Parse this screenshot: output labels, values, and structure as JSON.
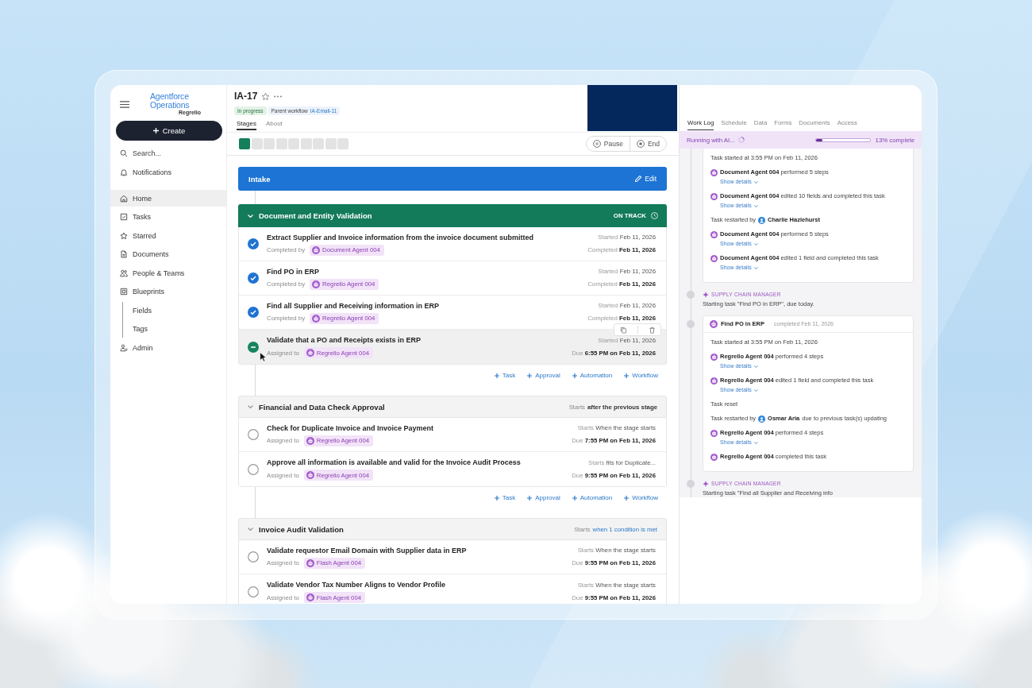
{
  "sidebar": {
    "logo": {
      "name": "Agentforce Operations",
      "byline": "Regrello"
    },
    "create_button": "Create",
    "search": {
      "placeholder": "Search..."
    },
    "top_items": [
      {
        "label": "Notifications",
        "selected": false
      }
    ],
    "items": [
      {
        "label": "Home",
        "selected": true
      },
      {
        "label": "Tasks",
        "selected": false
      },
      {
        "label": "Starred",
        "selected": false
      },
      {
        "label": "Documents",
        "selected": false
      },
      {
        "label": "People & Teams",
        "selected": false
      },
      {
        "label": "Blueprints",
        "selected": false,
        "children": [
          {
            "label": "Fields",
            "selected": false
          },
          {
            "label": "Tags",
            "selected": false
          }
        ]
      },
      {
        "label": "Admin",
        "selected": false
      }
    ]
  },
  "header": {
    "title": "IA-17",
    "starred": false,
    "status_badge": "In progress",
    "parent_label": "Parent workflow",
    "parent_link": "IA-Email-11",
    "tabs": [
      {
        "label": "Stages",
        "selected": true
      },
      {
        "label": "About",
        "selected": false
      }
    ]
  },
  "stage_progress": {
    "steps": [
      {
        "active": true
      },
      {
        "active": false
      },
      {
        "active": false
      },
      {
        "active": false
      },
      {
        "active": false
      },
      {
        "active": false
      },
      {
        "active": false
      },
      {
        "active": false
      },
      {
        "active": false
      }
    ]
  },
  "run_controls": [
    {
      "label": "Pause"
    },
    {
      "label": "End"
    }
  ],
  "stages": [
    {
      "name": "Intake",
      "kind": "intake",
      "edit_label": "Edit"
    },
    {
      "name": "Document and Entity Validation",
      "kind": "active",
      "expanded": true,
      "status_label": "ON TRACK",
      "tasks": [
        {
          "title": "Extract Supplier and Invoice information from the invoice document submitted",
          "checked": true,
          "in_progress": false,
          "hovered": false,
          "assignee_label": "Completed by",
          "assignee": "Document Agent 004",
          "start_label": "Started",
          "start_value": "Feb 11, 2026",
          "end_label": "Completed",
          "end_value": "Feb 11, 2026"
        },
        {
          "title": "Find PO in ERP",
          "checked": true,
          "in_progress": false,
          "hovered": false,
          "assignee_label": "Completed by",
          "assignee": "Regrello Agent 004",
          "start_label": "Started",
          "start_value": "Feb 11, 2026",
          "end_label": "Completed",
          "end_value": "Feb 11, 2026"
        },
        {
          "title": "Find all Supplier and Receiving information in ERP",
          "checked": true,
          "in_progress": false,
          "hovered": false,
          "assignee_label": "Completed by",
          "assignee": "Regrello Agent 004",
          "start_label": "Started",
          "start_value": "Feb 11, 2026",
          "end_label": "Completed",
          "end_value": "Feb 11, 2026"
        },
        {
          "title": "Validate that a PO and Receipts exists in ERP",
          "checked": false,
          "in_progress": true,
          "hovered": true,
          "assignee_label": "Assigned to",
          "assignee": "Regrello Agent 004",
          "start_label": "Started",
          "start_value": "Feb 11, 2026",
          "end_label": "Due",
          "end_value": "6:55 PM on Feb 11, 2026"
        }
      ],
      "add_actions": [
        "Task",
        "Approval",
        "Automation",
        "Workflow"
      ]
    },
    {
      "name": "Financial and Data Check Approval",
      "kind": "pending",
      "expanded": true,
      "starts_label": "Starts",
      "starts_value": "after the previous stage",
      "starts_linked": false,
      "tasks": [
        {
          "title": "Check for Duplicate Invoice and Invoice Payment",
          "checked": false,
          "in_progress": false,
          "hovered": false,
          "assignee_label": "Assigned to",
          "assignee": "Regrello Agent 004",
          "start_label": "Starts",
          "start_value": "When the stage starts",
          "end_label": "Due",
          "end_value": "7:55 PM on Feb 11, 2026"
        },
        {
          "title": "Approve all information is available and valid for the Invoice Audit Process",
          "checked": false,
          "in_progress": false,
          "hovered": false,
          "assignee_label": "Assigned to",
          "assignee": "Regrello Agent 004",
          "start_label": "Starts",
          "start_value": "fits for Duplicate...",
          "end_label": "Due",
          "end_value": "9:55 PM on Feb 11, 2026"
        }
      ],
      "add_actions": [
        "Task",
        "Approval",
        "Automation",
        "Workflow"
      ]
    },
    {
      "name": "Invoice Audit Validation",
      "kind": "pending",
      "expanded": true,
      "starts_label": "Starts",
      "starts_value": "when 1 condition is met",
      "starts_linked": true,
      "tasks": [
        {
          "title": "Validate requestor Email Domain with Supplier data in ERP",
          "checked": false,
          "in_progress": false,
          "hovered": false,
          "assignee_label": "Assigned to",
          "assignee": "Flash Agent 004",
          "start_label": "Starts",
          "start_value": "When the stage starts",
          "end_label": "Due",
          "end_value": "9:55 PM on Feb 11, 2026"
        },
        {
          "title": "Validate Vendor Tax Number Aligns to Vendor Profile",
          "checked": false,
          "in_progress": false,
          "hovered": false,
          "assignee_label": "Assigned to",
          "assignee": "Flash Agent 004",
          "start_label": "Starts",
          "start_value": "When the stage starts",
          "end_label": "Due",
          "end_value": "9:55 PM on Feb 11, 2026"
        }
      ]
    }
  ],
  "work_log": {
    "tabs": [
      {
        "label": "Work Log",
        "selected": true
      },
      {
        "label": "Schedule",
        "selected": false
      },
      {
        "label": "Data",
        "selected": false
      },
      {
        "label": "Forms",
        "selected": false
      },
      {
        "label": "Documents",
        "selected": false
      },
      {
        "label": "Access",
        "selected": false
      }
    ],
    "run_status": {
      "label": "Running with AI...",
      "level": 0.13,
      "reading": "13% complete"
    },
    "entries": [
      {
        "kind": "card",
        "lines": [
          {
            "kind": "note",
            "text": "Task started at 3:55 PM on Feb 11, 2026"
          },
          {
            "kind": "agent",
            "text": "**Document Agent 004** performed 5 steps",
            "details": "Show details"
          },
          {
            "kind": "agent",
            "text": "**Document Agent 004** edited 10 fields and completed this task",
            "details": "Show details"
          },
          {
            "kind": "user",
            "before": "Task restarted by",
            "name": "Charlie Hazlehurst"
          },
          {
            "kind": "agent",
            "text": "**Document Agent 004** performed 5 steps",
            "details": "Show details"
          },
          {
            "kind": "agent",
            "text": "**Document Agent 004** edited 1 field and completed this task",
            "details": "Show details"
          }
        ]
      },
      {
        "kind": "event",
        "actor": "SUPPLY CHAIN MANAGER",
        "text": "Starting task \"Find PO in ERP\", due today."
      },
      {
        "kind": "card",
        "title": "Find PO in ERP",
        "subtitle": "completed Feb 11, 2026",
        "lines": [
          {
            "kind": "note",
            "text": "Task started at 3:55 PM on Feb 11, 2026"
          },
          {
            "kind": "agent",
            "text": "**Regrello Agent 004** performed 4 steps",
            "details": "Show details"
          },
          {
            "kind": "agent",
            "text": "**Regrello Agent 004** edited 1 field and completed this task",
            "details": "Show details"
          },
          {
            "kind": "note",
            "text": "Task reset"
          },
          {
            "kind": "user",
            "before": "Task restarted by",
            "name": "Osmar Aria",
            "after": "due to previous task(s) updating"
          },
          {
            "kind": "agent",
            "text": "**Regrello Agent 004** performed 4 steps",
            "details": "Show details"
          },
          {
            "kind": "agent",
            "text": "**Regrello Agent 004** completed this task"
          }
        ]
      },
      {
        "kind": "event",
        "actor": "SUPPLY CHAIN MANAGER",
        "text": "Starting task \"Find all Supplier and Receiving info"
      }
    ]
  }
}
